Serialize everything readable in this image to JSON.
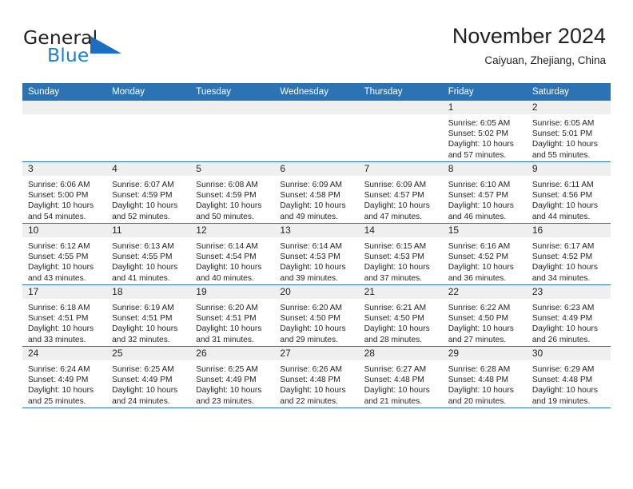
{
  "brand": {
    "word1": "General",
    "word2": "Blue",
    "logo_icon": "triangle-logo-icon",
    "accent_color": "#1b6ec2"
  },
  "header": {
    "month_title": "November 2024",
    "location": "Caiyuan, Zhejiang, China"
  },
  "calendar": {
    "header_color": "#2c73b4",
    "daynum_strip_color": "#efefef",
    "weekdays": [
      "Sunday",
      "Monday",
      "Tuesday",
      "Wednesday",
      "Thursday",
      "Friday",
      "Saturday"
    ],
    "weeks": [
      [
        {
          "day": "",
          "empty": true
        },
        {
          "day": "",
          "empty": true
        },
        {
          "day": "",
          "empty": true
        },
        {
          "day": "",
          "empty": true
        },
        {
          "day": "",
          "empty": true
        },
        {
          "day": "1",
          "sunrise": "Sunrise: 6:05 AM",
          "sunset": "Sunset: 5:02 PM",
          "daylight1": "Daylight: 10 hours",
          "daylight2": "and 57 minutes."
        },
        {
          "day": "2",
          "sunrise": "Sunrise: 6:05 AM",
          "sunset": "Sunset: 5:01 PM",
          "daylight1": "Daylight: 10 hours",
          "daylight2": "and 55 minutes."
        }
      ],
      [
        {
          "day": "3",
          "sunrise": "Sunrise: 6:06 AM",
          "sunset": "Sunset: 5:00 PM",
          "daylight1": "Daylight: 10 hours",
          "daylight2": "and 54 minutes."
        },
        {
          "day": "4",
          "sunrise": "Sunrise: 6:07 AM",
          "sunset": "Sunset: 4:59 PM",
          "daylight1": "Daylight: 10 hours",
          "daylight2": "and 52 minutes."
        },
        {
          "day": "5",
          "sunrise": "Sunrise: 6:08 AM",
          "sunset": "Sunset: 4:59 PM",
          "daylight1": "Daylight: 10 hours",
          "daylight2": "and 50 minutes."
        },
        {
          "day": "6",
          "sunrise": "Sunrise: 6:09 AM",
          "sunset": "Sunset: 4:58 PM",
          "daylight1": "Daylight: 10 hours",
          "daylight2": "and 49 minutes."
        },
        {
          "day": "7",
          "sunrise": "Sunrise: 6:09 AM",
          "sunset": "Sunset: 4:57 PM",
          "daylight1": "Daylight: 10 hours",
          "daylight2": "and 47 minutes."
        },
        {
          "day": "8",
          "sunrise": "Sunrise: 6:10 AM",
          "sunset": "Sunset: 4:57 PM",
          "daylight1": "Daylight: 10 hours",
          "daylight2": "and 46 minutes."
        },
        {
          "day": "9",
          "sunrise": "Sunrise: 6:11 AM",
          "sunset": "Sunset: 4:56 PM",
          "daylight1": "Daylight: 10 hours",
          "daylight2": "and 44 minutes."
        }
      ],
      [
        {
          "day": "10",
          "sunrise": "Sunrise: 6:12 AM",
          "sunset": "Sunset: 4:55 PM",
          "daylight1": "Daylight: 10 hours",
          "daylight2": "and 43 minutes."
        },
        {
          "day": "11",
          "sunrise": "Sunrise: 6:13 AM",
          "sunset": "Sunset: 4:55 PM",
          "daylight1": "Daylight: 10 hours",
          "daylight2": "and 41 minutes."
        },
        {
          "day": "12",
          "sunrise": "Sunrise: 6:14 AM",
          "sunset": "Sunset: 4:54 PM",
          "daylight1": "Daylight: 10 hours",
          "daylight2": "and 40 minutes."
        },
        {
          "day": "13",
          "sunrise": "Sunrise: 6:14 AM",
          "sunset": "Sunset: 4:53 PM",
          "daylight1": "Daylight: 10 hours",
          "daylight2": "and 39 minutes."
        },
        {
          "day": "14",
          "sunrise": "Sunrise: 6:15 AM",
          "sunset": "Sunset: 4:53 PM",
          "daylight1": "Daylight: 10 hours",
          "daylight2": "and 37 minutes."
        },
        {
          "day": "15",
          "sunrise": "Sunrise: 6:16 AM",
          "sunset": "Sunset: 4:52 PM",
          "daylight1": "Daylight: 10 hours",
          "daylight2": "and 36 minutes."
        },
        {
          "day": "16",
          "sunrise": "Sunrise: 6:17 AM",
          "sunset": "Sunset: 4:52 PM",
          "daylight1": "Daylight: 10 hours",
          "daylight2": "and 34 minutes."
        }
      ],
      [
        {
          "day": "17",
          "sunrise": "Sunrise: 6:18 AM",
          "sunset": "Sunset: 4:51 PM",
          "daylight1": "Daylight: 10 hours",
          "daylight2": "and 33 minutes."
        },
        {
          "day": "18",
          "sunrise": "Sunrise: 6:19 AM",
          "sunset": "Sunset: 4:51 PM",
          "daylight1": "Daylight: 10 hours",
          "daylight2": "and 32 minutes."
        },
        {
          "day": "19",
          "sunrise": "Sunrise: 6:20 AM",
          "sunset": "Sunset: 4:51 PM",
          "daylight1": "Daylight: 10 hours",
          "daylight2": "and 31 minutes."
        },
        {
          "day": "20",
          "sunrise": "Sunrise: 6:20 AM",
          "sunset": "Sunset: 4:50 PM",
          "daylight1": "Daylight: 10 hours",
          "daylight2": "and 29 minutes."
        },
        {
          "day": "21",
          "sunrise": "Sunrise: 6:21 AM",
          "sunset": "Sunset: 4:50 PM",
          "daylight1": "Daylight: 10 hours",
          "daylight2": "and 28 minutes."
        },
        {
          "day": "22",
          "sunrise": "Sunrise: 6:22 AM",
          "sunset": "Sunset: 4:50 PM",
          "daylight1": "Daylight: 10 hours",
          "daylight2": "and 27 minutes."
        },
        {
          "day": "23",
          "sunrise": "Sunrise: 6:23 AM",
          "sunset": "Sunset: 4:49 PM",
          "daylight1": "Daylight: 10 hours",
          "daylight2": "and 26 minutes."
        }
      ],
      [
        {
          "day": "24",
          "sunrise": "Sunrise: 6:24 AM",
          "sunset": "Sunset: 4:49 PM",
          "daylight1": "Daylight: 10 hours",
          "daylight2": "and 25 minutes."
        },
        {
          "day": "25",
          "sunrise": "Sunrise: 6:25 AM",
          "sunset": "Sunset: 4:49 PM",
          "daylight1": "Daylight: 10 hours",
          "daylight2": "and 24 minutes."
        },
        {
          "day": "26",
          "sunrise": "Sunrise: 6:25 AM",
          "sunset": "Sunset: 4:49 PM",
          "daylight1": "Daylight: 10 hours",
          "daylight2": "and 23 minutes."
        },
        {
          "day": "27",
          "sunrise": "Sunrise: 6:26 AM",
          "sunset": "Sunset: 4:48 PM",
          "daylight1": "Daylight: 10 hours",
          "daylight2": "and 22 minutes."
        },
        {
          "day": "28",
          "sunrise": "Sunrise: 6:27 AM",
          "sunset": "Sunset: 4:48 PM",
          "daylight1": "Daylight: 10 hours",
          "daylight2": "and 21 minutes."
        },
        {
          "day": "29",
          "sunrise": "Sunrise: 6:28 AM",
          "sunset": "Sunset: 4:48 PM",
          "daylight1": "Daylight: 10 hours",
          "daylight2": "and 20 minutes."
        },
        {
          "day": "30",
          "sunrise": "Sunrise: 6:29 AM",
          "sunset": "Sunset: 4:48 PM",
          "daylight1": "Daylight: 10 hours",
          "daylight2": "and 19 minutes."
        }
      ]
    ]
  }
}
